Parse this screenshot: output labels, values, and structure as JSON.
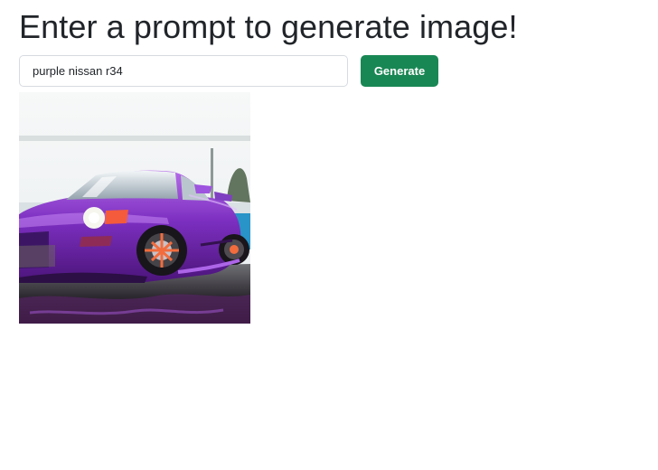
{
  "header": {
    "title": "Enter a prompt to generate image!"
  },
  "prompt": {
    "value": "purple nissan r34",
    "placeholder": ""
  },
  "actions": {
    "generate_label": "Generate"
  },
  "result": {
    "image_subject": "purple-car-image"
  },
  "colors": {
    "button": "#198754",
    "text": "#212529",
    "input_border": "#d7dbe0",
    "car_purple": "#7b2fb8"
  }
}
